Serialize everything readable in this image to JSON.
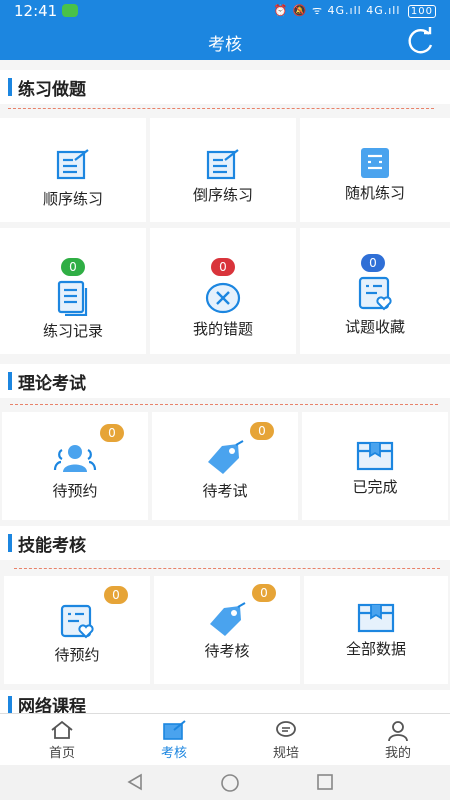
{
  "status_bar": {
    "time": "12:41",
    "indicators": "⏰ 🔕 ᯤ 4G.ıll 4G.ıll",
    "battery": "100"
  },
  "header": {
    "title": "考核",
    "refresh_icon": "refresh-icon"
  },
  "sections": {
    "practice": {
      "title": "练习做题",
      "tiles": [
        {
          "label": "顺序练习",
          "icon": "edit-doc-icon"
        },
        {
          "label": "倒序练习",
          "icon": "edit-doc-icon"
        },
        {
          "label": "随机练习",
          "icon": "random-card-icon"
        },
        {
          "label": "练习记录",
          "icon": "record-stack-icon",
          "badge": "0"
        },
        {
          "label": "我的错题",
          "icon": "error-circle-icon",
          "badge": "0"
        },
        {
          "label": "试题收藏",
          "icon": "favorite-doc-icon",
          "badge": "0"
        }
      ]
    },
    "theory": {
      "title": "理论考试",
      "tiles": [
        {
          "label": "待预约",
          "icon": "people-icon",
          "badge": "0"
        },
        {
          "label": "待考试",
          "icon": "tag-icon",
          "badge": "0"
        },
        {
          "label": "已完成",
          "icon": "box-icon"
        }
      ]
    },
    "skill": {
      "title": "技能考核",
      "tiles": [
        {
          "label": "待预约",
          "icon": "favorite-doc-icon",
          "badge": "0"
        },
        {
          "label": "待考核",
          "icon": "tag-icon",
          "badge": "0"
        },
        {
          "label": "全部数据",
          "icon": "box-icon"
        }
      ]
    },
    "online": {
      "title": "网络课程"
    }
  },
  "bottom_nav": [
    {
      "label": "首页",
      "icon": "home-icon",
      "active": false
    },
    {
      "label": "考核",
      "icon": "exam-icon",
      "active": true
    },
    {
      "label": "规培",
      "icon": "chat-icon",
      "active": false
    },
    {
      "label": "我的",
      "icon": "user-icon",
      "active": false
    }
  ],
  "colors": {
    "primary": "#1c86e0",
    "green": "#2fae44",
    "red": "#d9343b",
    "blue": "#2f6fd6",
    "orange": "#e6a437",
    "dashed": "#e8826a"
  }
}
